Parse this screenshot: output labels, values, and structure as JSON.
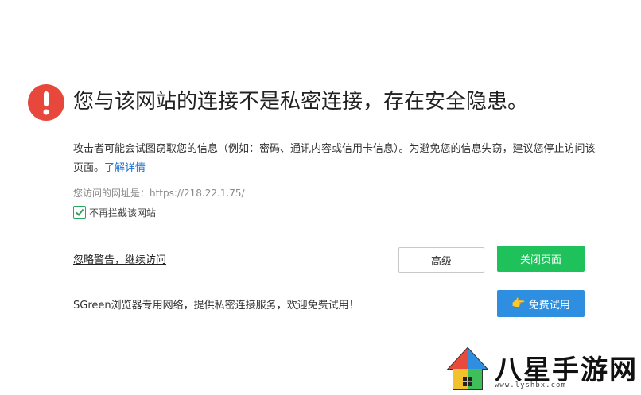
{
  "headline": "您与该网站的连接不是私密连接，存在安全隐患。",
  "description": {
    "text": "攻击者可能会试图窃取您的信息（例如：密码、通讯内容或信用卡信息）。为避免您的信息失窃，建议您停止访问该页面。",
    "learn_more_link": "了解详情"
  },
  "url_line": "您访问的网址是：https://218.22.1.75/",
  "checkbox": {
    "label": "不再拦截该网站",
    "checked": true
  },
  "ignore_link": "忽略警告，继续访问",
  "buttons": {
    "advanced": "高级",
    "close_page": "关闭页面",
    "free_trial": "免费试用"
  },
  "promo_text": "SGreen浏览器专用网络，提供私密连接服务，欢迎免费试用！",
  "watermark": {
    "title": "八星手游网",
    "url": "www.lyshbx.com"
  },
  "colors": {
    "warning": "#e8483c",
    "close_button": "#1fc25a",
    "trial_button": "#2e8ee0",
    "link": "#1a6fd1"
  },
  "icons": {
    "warning": "exclamation-circle-icon",
    "checkbox": "checkmark-icon",
    "trial": "pointing-hand-icon"
  }
}
